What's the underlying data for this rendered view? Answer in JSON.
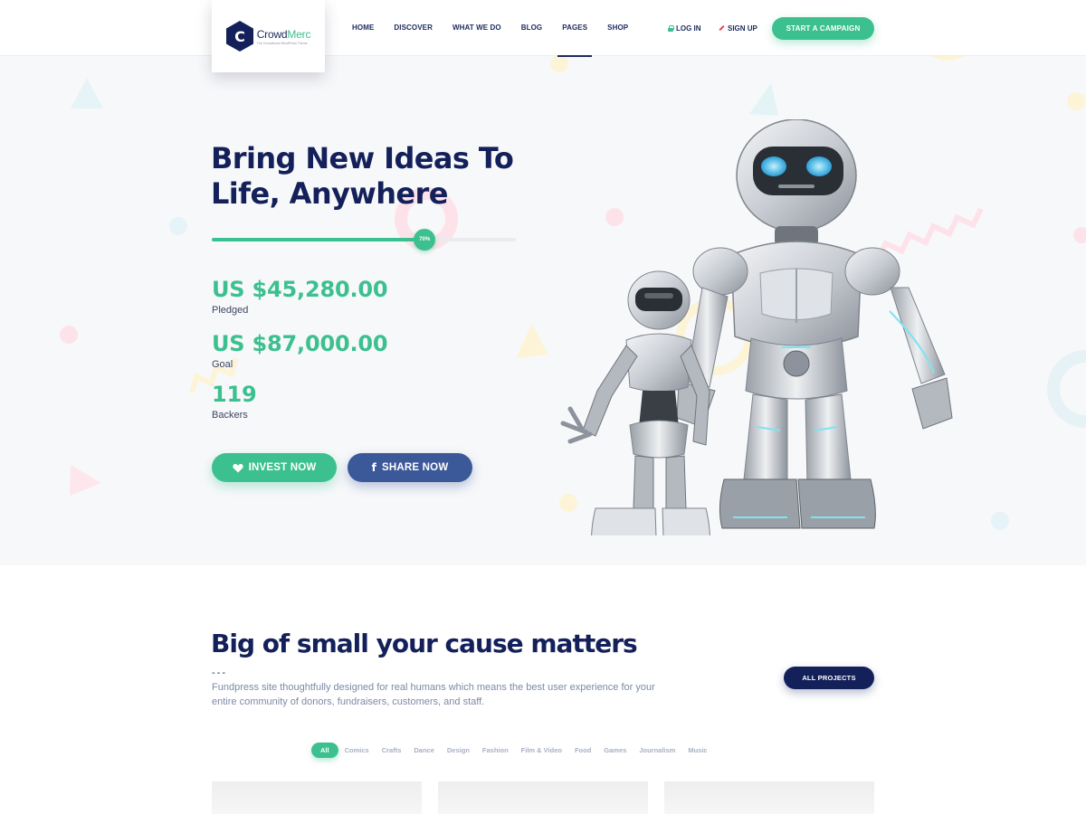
{
  "brand": {
    "name_part1": "Crowd",
    "name_part2": "Merc",
    "tagline": "The Crowdfound WordPress Theme",
    "logo_letter": "C"
  },
  "nav": {
    "items": [
      {
        "label": "HOME"
      },
      {
        "label": "DISCOVER"
      },
      {
        "label": "WHAT WE DO"
      },
      {
        "label": "BLOG"
      },
      {
        "label": "PAGES",
        "active": true
      },
      {
        "label": "SHOP"
      }
    ]
  },
  "auth": {
    "login": "LOG IN",
    "signup": "SIGN UP"
  },
  "header": {
    "cta": "START A CAMPAIGN"
  },
  "hero": {
    "title_line1": "Bring New Ideas To",
    "title_line2": "Life, Anywhere",
    "progress": {
      "percent": 70,
      "label": "70%"
    },
    "stats": [
      {
        "value": "US $45,280.00",
        "label": "Pledged"
      },
      {
        "value": "US $87,000.00",
        "label": "Goal"
      },
      {
        "value": "119",
        "label": "Backers"
      }
    ],
    "invest_label": "INVEST NOW",
    "share_label": "SHARE NOW",
    "share_icon": "f"
  },
  "projects": {
    "title": "Big of small your cause matters",
    "dash": "---",
    "description": "Fundpress site thoughtfully designed for real humans which means the best user experience for your entire community of donors, fundraisers, customers, and staff.",
    "all_label": "ALL PROJECTS",
    "filters": [
      "All",
      "Comics",
      "Crafts",
      "Dance",
      "Design",
      "Fashion",
      "Film & Video",
      "Food",
      "Games",
      "Journalism",
      "Music"
    ]
  },
  "colors": {
    "accent": "#3cc08f",
    "navy": "#14205a",
    "facebook": "#3b5998",
    "hero_bg": "#f7f8fa"
  }
}
